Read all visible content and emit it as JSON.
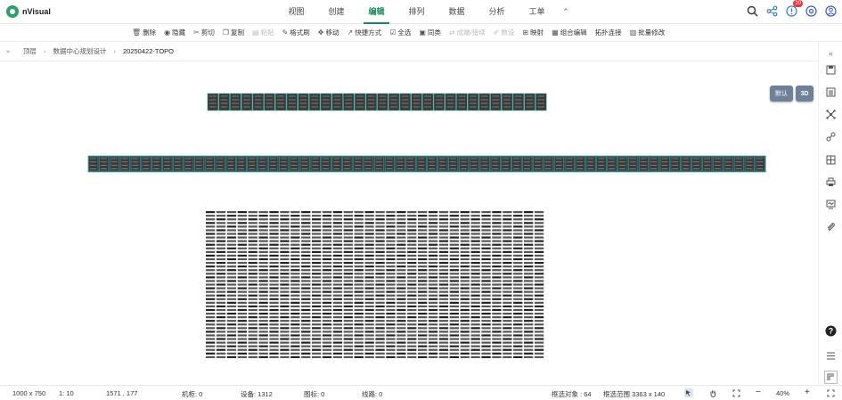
{
  "app": {
    "name": "nVisual"
  },
  "menu": {
    "items": [
      "视图",
      "创建",
      "编辑",
      "排列",
      "数据",
      "分析",
      "工单"
    ],
    "active_index": 2,
    "collapse_icon": "chevron-up-icon"
  },
  "top_right": {
    "icons": [
      "search-icon",
      "share-icon",
      "notification-icon",
      "settings-icon",
      "user-icon"
    ],
    "notification_count": "20"
  },
  "toolbar": {
    "items": [
      {
        "label": "删除",
        "icon": "trash-icon",
        "enabled": true
      },
      {
        "label": "隐藏",
        "icon": "eye-icon",
        "enabled": true
      },
      {
        "label": "剪切",
        "icon": "scissors-icon",
        "enabled": true
      },
      {
        "label": "复制",
        "icon": "copy-icon",
        "enabled": true
      },
      {
        "label": "粘贴",
        "icon": "paste-icon",
        "enabled": false
      },
      {
        "label": "格式刷",
        "icon": "brush-icon",
        "enabled": true
      },
      {
        "label": "移动",
        "icon": "move-icon",
        "enabled": true
      },
      {
        "label": "快捷方式",
        "icon": "shortcut-icon",
        "enabled": true
      },
      {
        "label": "全选",
        "icon": "select-all-icon",
        "enabled": true
      },
      {
        "label": "同类",
        "icon": "same-type-icon",
        "enabled": true
      },
      {
        "label": "成端/接续",
        "icon": "splice-icon",
        "enabled": false
      },
      {
        "label": "数设",
        "icon": "data-set-icon",
        "enabled": false
      },
      {
        "label": "映射",
        "icon": "map-icon",
        "enabled": true
      },
      {
        "label": "组合编辑",
        "icon": "group-edit-icon",
        "enabled": true
      },
      {
        "label": "拓扑连接",
        "icon": "",
        "enabled": true
      },
      {
        "label": "批量修改",
        "icon": "batch-edit-icon",
        "enabled": true
      }
    ]
  },
  "breadcrumb": {
    "expand_icon": "double-chevron-right-icon",
    "items": [
      "顶层",
      "数据中心规划设计",
      "20250422-TOPO"
    ]
  },
  "view_buttons": {
    "default_label": "默认",
    "threed_label": "3D"
  },
  "right_sidebar": {
    "icons": [
      "double-chevron-left-icon",
      "save-icon",
      "list-icon",
      "network-icon",
      "link-icon",
      "layout-icon",
      "print-icon",
      "monitor-icon",
      "attach-icon",
      "help-icon",
      "menu-icon"
    ]
  },
  "status": {
    "canvas_size": "1000 x 750",
    "scale": "1: 10",
    "coords": "1571 , 177",
    "cabinets": "机柜: 0",
    "devices": "设备: 1312",
    "icons": "图标: 0",
    "lines": "线路: 0",
    "selected": "框选对象 : 64",
    "range": "框选范围  3363 x 140",
    "zoom": "40%"
  },
  "colors": {
    "accent": "#1a8a5a",
    "button": "#6f8199",
    "rack_border": "#2aa1a1",
    "rack_fill": "#3a3a3a"
  }
}
